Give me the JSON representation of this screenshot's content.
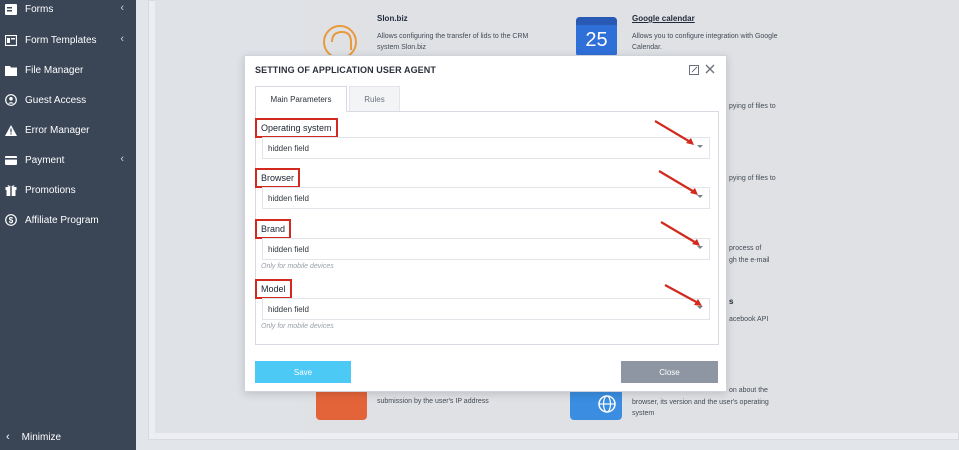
{
  "sidebar": {
    "items": [
      {
        "label": "Forms",
        "icon": "forms-icon",
        "has_chevron": true
      },
      {
        "label": "Form Templates",
        "icon": "form-templates-icon",
        "has_chevron": true
      },
      {
        "label": "File Manager",
        "icon": "file-manager-icon",
        "has_chevron": false
      },
      {
        "label": "Guest Access",
        "icon": "guest-access-icon",
        "has_chevron": false
      },
      {
        "label": "Error Manager",
        "icon": "error-manager-icon",
        "has_chevron": false
      },
      {
        "label": "Payment",
        "icon": "payment-icon",
        "has_chevron": true
      },
      {
        "label": "Promotions",
        "icon": "promotions-icon",
        "has_chevron": false
      },
      {
        "label": "Affiliate Program",
        "icon": "affiliate-program-icon",
        "has_chevron": false
      }
    ],
    "minimize_label": "Minimize",
    "chevron_glyph": "‹"
  },
  "background": {
    "slon": {
      "title": "Slon.biz",
      "desc": "Allows configuring the transfer of lids to the CRM system Slon.biz"
    },
    "gcal": {
      "title": "Google calendar",
      "desc": "Allows you to configure integration with Google Calendar.",
      "day": "25"
    },
    "frag1": "pying of files to",
    "frag2": "pying of files to",
    "frag3a": "process of",
    "frag3b": "gh the e-mail",
    "frag4a": "s",
    "frag4b": "acebook API",
    "frag5a": "submission by the user's IP address",
    "frag5b": "on about the",
    "frag5c": "browser, its version and the user's operating",
    "frag5d": "system"
  },
  "modal": {
    "title": "SETTING OF APPLICATION USER AGENT",
    "tabs": {
      "main": "Main Parameters",
      "rules": "Rules"
    },
    "fields": [
      {
        "label": "Operating system",
        "value": "hidden field",
        "hint": ""
      },
      {
        "label": "Browser",
        "value": "hidden field",
        "hint": ""
      },
      {
        "label": "Brand",
        "value": "hidden field",
        "hint": "Only for mobile devices"
      },
      {
        "label": "Model",
        "value": "hidden field",
        "hint": "Only for mobile devices"
      }
    ],
    "save_label": "Save",
    "close_label": "Close"
  },
  "colors": {
    "sidebar_bg": "#3a4556",
    "annotation_red": "#d22a1e",
    "save_button": "#4cc9f5",
    "close_button": "#8d96a2"
  }
}
